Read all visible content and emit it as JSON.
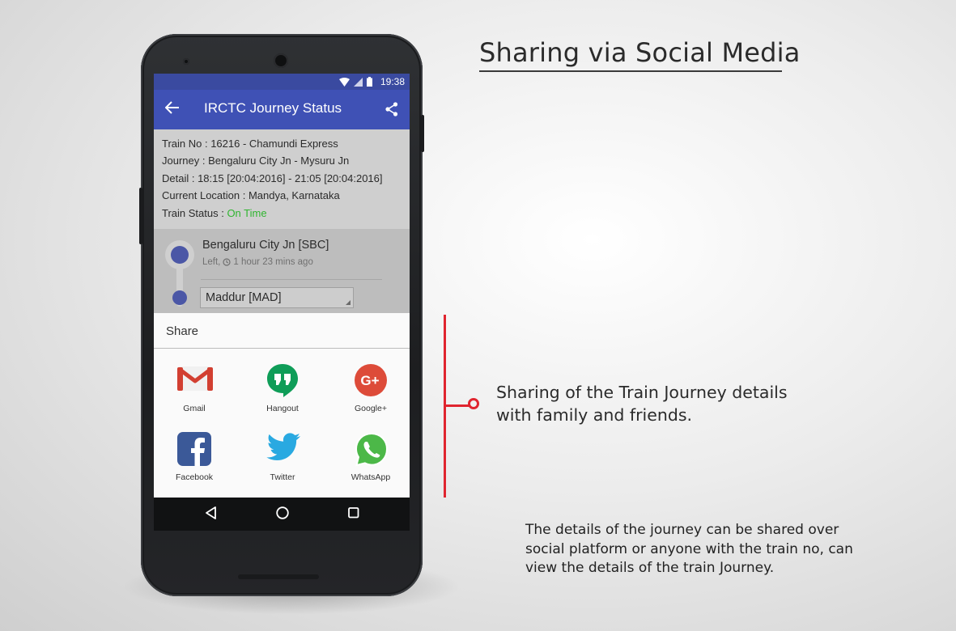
{
  "status_bar": {
    "time": "19:38"
  },
  "app_bar": {
    "title": "IRCTC Journey Status"
  },
  "journey": {
    "train_no_label": "Train No : ",
    "train_no_value": "16216 - Chamundi Express",
    "journey_label": "Journey : ",
    "journey_value": "Bengaluru City Jn - Mysuru Jn",
    "detail_label": "Detail : ",
    "detail_value": "18:15 [20:04:2016] - 21:05 [20:04:2016]",
    "location_label": "Current Location : ",
    "location_value": "Mandya, Karnataka",
    "status_label": "Train Status : ",
    "status_value": "On Time"
  },
  "stations": {
    "first_name": "Bengaluru City Jn [SBC]",
    "first_sub_prefix": "Left,",
    "first_sub_time": "1 hour  23 mins ago",
    "next_station": "Maddur [MAD]"
  },
  "share_sheet": {
    "title": "Share",
    "apps": [
      {
        "label": "Gmail",
        "icon": "gmail-icon"
      },
      {
        "label": "Hangout",
        "icon": "hangouts-icon"
      },
      {
        "label": "Google+",
        "icon": "google-plus-icon"
      },
      {
        "label": "Facebook",
        "icon": "facebook-icon"
      },
      {
        "label": "Twitter",
        "icon": "twitter-icon"
      },
      {
        "label": "WhatsApp",
        "icon": "whatsapp-icon"
      }
    ]
  },
  "promo": {
    "headline": "Sharing via Social Media",
    "callout_line1": "Sharing of the Train Journey details",
    "callout_line2": "with family and friends.",
    "body_line1": "The details of the journey can be shared over",
    "body_line2": "social platform or anyone with the train no, can",
    "body_line3": "view the details of the train Journey."
  },
  "colors": {
    "app_bar": "#3f51b5",
    "status_bar": "#3a4aa0",
    "on_time": "#2fb52f",
    "accent_red": "#e0252f"
  }
}
